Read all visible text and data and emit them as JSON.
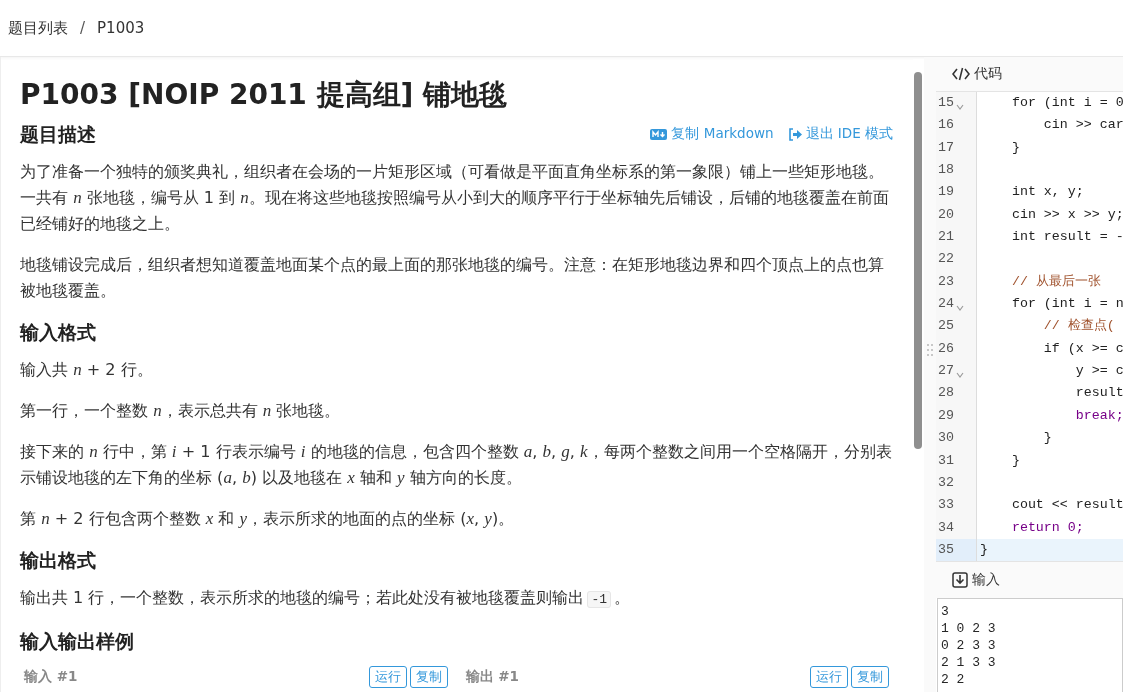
{
  "breadcrumb": {
    "items": [
      {
        "label": "题目列表"
      },
      {
        "label": "P1003"
      }
    ],
    "separator": "/"
  },
  "problem": {
    "title": "P1003 [NOIP 2011 提高组] 铺地毯",
    "actions": [
      {
        "label": "复制 Markdown"
      },
      {
        "label": "退出 IDE 模式"
      }
    ],
    "sections": [
      {
        "heading": "题目描述",
        "paragraphs": [
          [
            {
              "kind": "text",
              "text": "为了准备一个独特的颁奖典礼，组织者在会场的一片矩形区域（可看做是平面直角坐标系的第一象限）铺上一些矩形地毯。一共有 *n* 张地毯，编号从 1 到 *n*。现在将这些地毯按照编号从小到大的顺序平行于坐标轴先后铺设，后铺的地毯覆盖在前面已经铺好的地毯之上。"
            }
          ],
          [
            {
              "kind": "text",
              "text": "地毯铺设完成后，组织者想知道覆盖地面某个点的最上面的那张地毯的编号。注意：在矩形地毯边界和四个顶点上的点也算被地毯覆盖。"
            }
          ]
        ]
      },
      {
        "heading": "输入格式",
        "paragraphs": [
          [
            {
              "kind": "text",
              "text": "输入共 *n* + 2 行。"
            }
          ],
          [
            {
              "kind": "text",
              "text": "第一行，一个整数 *n*，表示总共有 *n* 张地毯。"
            }
          ],
          [
            {
              "kind": "text",
              "text": "接下来的 *n* 行中，第 *i* + 1 行表示编号 *i* 的地毯的信息，包含四个整数 *a*, *b*, *g*, *k*，每两个整数之间用一个空格隔开，分别表示铺设地毯的左下角的坐标 (*a*, *b*) 以及地毯在 *x* 轴和 *y* 轴方向的长度。"
            }
          ],
          [
            {
              "kind": "text",
              "text": "第 *n* + 2 行包含两个整数 *x* 和 *y*，表示所求的地面的点的坐标 (*x*, *y*)。"
            }
          ]
        ]
      },
      {
        "heading": "输出格式",
        "paragraphs": [
          [
            {
              "kind": "text",
              "text": "输出共 1 行，一个整数，表示所求的地毯的编号；若此处没有被地毯覆盖则输出"
            },
            {
              "kind": "code",
              "text": "-1"
            },
            {
              "kind": "text",
              "text": "。"
            }
          ]
        ]
      }
    ],
    "samples": {
      "heading": "输入输出样例",
      "items": [
        {
          "label": "输入 #1",
          "buttons": [
            "运行",
            "复制"
          ]
        },
        {
          "label": "输出 #1",
          "buttons": [
            "运行",
            "复制"
          ]
        }
      ]
    }
  },
  "editor": {
    "title": "代码",
    "lines": [
      {
        "number": "15",
        "text": "    for (int i = 0",
        "foldable": true,
        "current": false,
        "kind": "code"
      },
      {
        "number": "16",
        "text": "        cin >> car",
        "foldable": false,
        "current": false,
        "kind": "code"
      },
      {
        "number": "17",
        "text": "    }",
        "foldable": false,
        "current": false,
        "kind": "code"
      },
      {
        "number": "18",
        "foldable": false,
        "current": false,
        "kind": "code"
      },
      {
        "number": "19",
        "text": "    int x, y;",
        "foldable": false,
        "current": false,
        "kind": "code"
      },
      {
        "number": "20",
        "text": "    cin >> x >> y;",
        "foldable": false,
        "current": false,
        "kind": "code"
      },
      {
        "number": "21",
        "text": "    int result = -",
        "foldable": false,
        "current": false,
        "kind": "code"
      },
      {
        "number": "22",
        "foldable": false,
        "current": false,
        "kind": "code"
      },
      {
        "number": "23",
        "text": "    // 从最后一张",
        "foldable": false,
        "current": false,
        "kind": "comment"
      },
      {
        "number": "24",
        "text": "    for (int i = n",
        "foldable": true,
        "current": false,
        "kind": "code"
      },
      {
        "number": "25",
        "text": "        // 检查点(",
        "foldable": false,
        "current": false,
        "kind": "comment"
      },
      {
        "number": "26",
        "text": "        if (x >= c",
        "foldable": false,
        "current": false,
        "kind": "code"
      },
      {
        "number": "27",
        "text": "            y >= c",
        "foldable": true,
        "current": false,
        "kind": "code"
      },
      {
        "number": "28",
        "text": "            result",
        "foldable": false,
        "current": false,
        "kind": "code"
      },
      {
        "number": "29",
        "text": "            break;",
        "foldable": false,
        "current": false,
        "kind": "keyword"
      },
      {
        "number": "30",
        "text": "        }",
        "foldable": false,
        "current": false,
        "kind": "code"
      },
      {
        "number": "31",
        "text": "    }",
        "foldable": false,
        "current": false,
        "kind": "code"
      },
      {
        "number": "32",
        "foldable": false,
        "current": false,
        "kind": "code"
      },
      {
        "number": "33",
        "text": "    cout << result",
        "foldable": false,
        "current": false,
        "kind": "code"
      },
      {
        "number": "34",
        "text": "    return 0;",
        "foldable": false,
        "current": false,
        "kind": "keyword"
      },
      {
        "number": "35",
        "text": "}",
        "foldable": false,
        "current": true,
        "kind": "code"
      }
    ]
  },
  "input_panel": {
    "title": "输入",
    "lines": [
      "3",
      "1 0 2 3",
      "0 2 3 3",
      "2 1 3 3",
      "2 2"
    ]
  }
}
